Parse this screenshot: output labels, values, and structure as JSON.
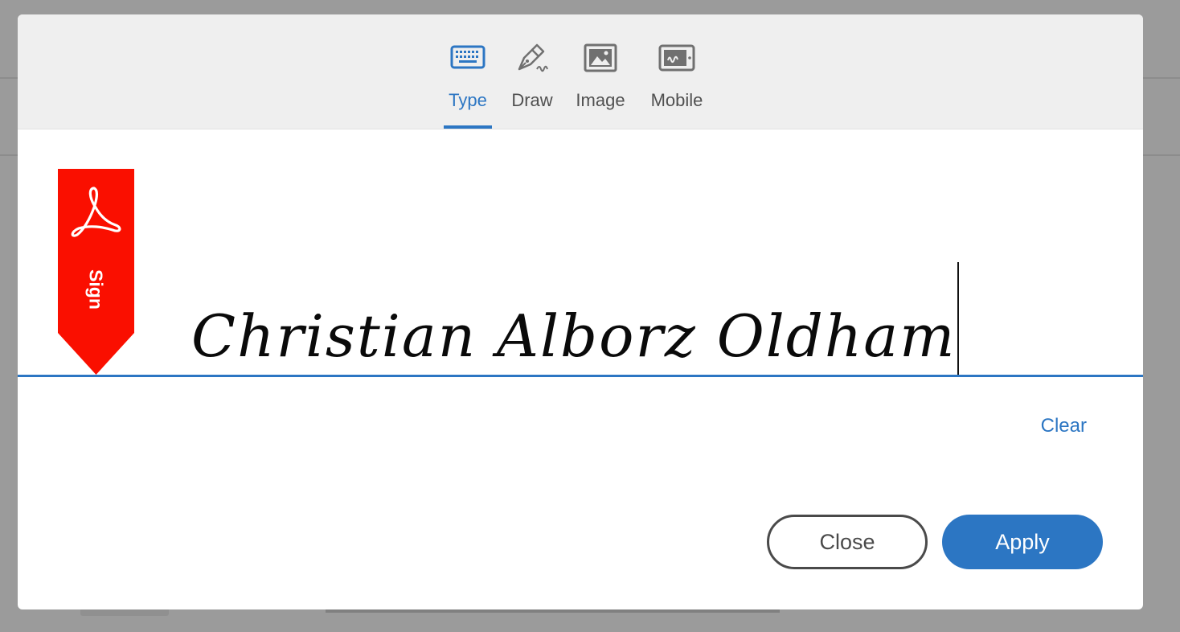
{
  "tabs": [
    {
      "label": "Type",
      "icon": "keyboard-icon",
      "active": true
    },
    {
      "label": "Draw",
      "icon": "pen-icon",
      "active": false
    },
    {
      "label": "Image",
      "icon": "image-icon",
      "active": false
    },
    {
      "label": "Mobile",
      "icon": "mobile-icon",
      "active": false
    }
  ],
  "ribbon": {
    "label": "Sign",
    "icon": "acrobat-logo-icon",
    "color": "#fa0f00"
  },
  "signature": {
    "value": "Christian Alborz Oldham"
  },
  "actions": {
    "clear_label": "Clear",
    "close_label": "Close",
    "apply_label": "Apply"
  },
  "colors": {
    "accent": "#2c76c3",
    "backdrop": "#9b9b9b"
  }
}
